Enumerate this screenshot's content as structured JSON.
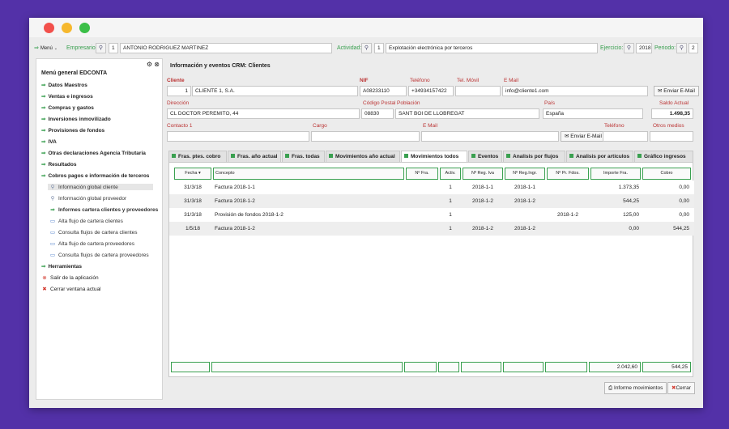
{
  "toolbar": {
    "menu_label": "Menú",
    "empresario_label": "Empresario:",
    "empresario_code": "1",
    "empresario_name": "ANTONIO RODRIGUEZ MARTINEZ",
    "actividad_label": "Actividad:",
    "actividad_code": "1",
    "actividad_name": "Explotación electrónica por terceros",
    "ejercicio_label": "Ejercicio:",
    "ejercicio_value": "2018",
    "periodo_label": "Periodo:",
    "periodo_value": "2"
  },
  "sidebar": {
    "title": "Menú general EDCONTA",
    "items": [
      {
        "label": "Datos Maestros"
      },
      {
        "label": "Ventas e ingresos"
      },
      {
        "label": "Compras y gastos"
      },
      {
        "label": "Inversiones inmovilizado"
      },
      {
        "label": "Provisiones de fondos"
      },
      {
        "label": "IVA"
      },
      {
        "label": "Otras declaraciones Agencia Tributaria"
      },
      {
        "label": "Resultados"
      },
      {
        "label": "Cobros pagos e información de terceros"
      }
    ],
    "subitems": [
      {
        "label": "Información global cliente"
      },
      {
        "label": "Información global proveedor"
      },
      {
        "label": "Informes cartera clientes y proveedores"
      },
      {
        "label": "Alta flujo de cartera clientes"
      },
      {
        "label": "Consulta flujos de cartera clientes"
      },
      {
        "label": "Alta flujo de cartera proveedores"
      },
      {
        "label": "Consulta flujos de cartera proveedores"
      }
    ],
    "herramientas": "Herramientas",
    "salir": "Salir de la aplicación",
    "cerrar": "Cerrar ventana actual"
  },
  "panel": {
    "title": "Información y eventos CRM: Clientes",
    "labels": {
      "cliente": "Cliente",
      "nif": "NIF",
      "telefono": "Teléfono",
      "tel_movil": "Tel. Móvil",
      "email": "E Mail",
      "direccion": "Dirección",
      "cp": "Código Postal",
      "poblacion": "Población",
      "pais": "País",
      "saldo": "Saldo Actual",
      "contacto": "Contacto 1",
      "cargo": "Cargo",
      "email2": "E Mail",
      "telefono2": "Teléfono",
      "otros": "Otros medios"
    },
    "values": {
      "cliente_code": "1",
      "cliente_name": "CLIENTE 1, S.A.",
      "nif": "A08233110",
      "telefono": "+34934157422",
      "email": "info@cliente1.com",
      "direccion": "CL DOCTOR PEREMITO, 44",
      "cp": "08830",
      "poblacion": "SANT BOI DE LLOBREGAT",
      "pais": "España",
      "saldo": "1.498,35"
    },
    "enviar_email_1": "Enviar E-Mail",
    "enviar_email_2": "Enviar E-Mail"
  },
  "tabs": [
    {
      "label": "Fras. ptes. cobro"
    },
    {
      "label": "Fras. año actual"
    },
    {
      "label": "Fras. todas"
    },
    {
      "label": "Movimientos año actual"
    },
    {
      "label": "Movimientos todos"
    },
    {
      "label": "Eventos"
    },
    {
      "label": "Analisis por flujos"
    },
    {
      "label": "Analisis por articulos"
    },
    {
      "label": "Gráfico ingresos"
    }
  ],
  "table": {
    "columns": [
      "Fecha",
      "Concepto",
      "Nº Fra.",
      "Activ.",
      "Nº Reg. Iva",
      "Nº Reg.Ingr.",
      "Nº Pr. Fdos.",
      "Importe Fra.",
      "Cobro"
    ],
    "rows": [
      [
        "31/3/18",
        "Factura 2018-1-1",
        "",
        "1",
        "2018-1-1",
        "2018-1-1",
        "",
        "1.373,35",
        "0,00"
      ],
      [
        "31/3/18",
        "Factura 2018-1-2",
        "",
        "1",
        "2018-1-2",
        "2018-1-2",
        "",
        "544,25",
        "0,00"
      ],
      [
        "31/3/18",
        "Provisión de fondos 2018-1-2",
        "",
        "1",
        "",
        "",
        "2018-1-2",
        "125,00",
        "0,00"
      ],
      [
        "1/5/18",
        "Factura 2018-1-2",
        "",
        "1",
        "2018-1-2",
        "2018-1-2",
        "",
        "0,00",
        "544,25"
      ]
    ],
    "total_importe": "2.042,60",
    "total_cobro": "544,25"
  },
  "footer": {
    "informe": "Informe movimientos",
    "cerrar": "Cerrar"
  }
}
